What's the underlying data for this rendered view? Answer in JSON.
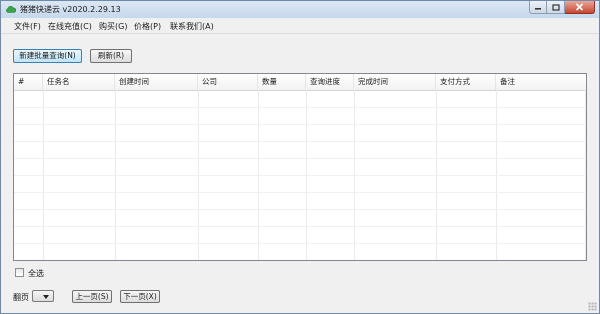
{
  "window": {
    "title": "猪猪快递云 v2020.2.29.13",
    "controls": [
      "minimize",
      "maximize",
      "close"
    ]
  },
  "menu": {
    "items": [
      "文件(F)",
      "在线充值(C)",
      "购买(G)",
      "价格(P)",
      "联系我们(A)"
    ]
  },
  "toolbar": {
    "new_batch_query": "新建批量查询(N)",
    "refresh": "刷新(R)"
  },
  "table": {
    "columns": [
      "#",
      "任务名",
      "创建时间",
      "公司",
      "数量",
      "查询进度",
      "完成时间",
      "支付方式",
      "备注"
    ],
    "rows": []
  },
  "footer": {
    "select_all": "全选",
    "select_all_checked": false,
    "page_label": "翻页",
    "page_value": "",
    "prev_page": "上一页(S)",
    "next_page": "下一页(X)"
  },
  "icons": {
    "app": "cloud-icon",
    "min": "minimize-icon",
    "max": "maximize-icon",
    "close": "close-icon"
  },
  "colors": {
    "titlebar": "#c6d8ec",
    "close_button": "#c7452f",
    "focused_button": "#3c7fb1",
    "app_icon": "#3aa64a"
  }
}
